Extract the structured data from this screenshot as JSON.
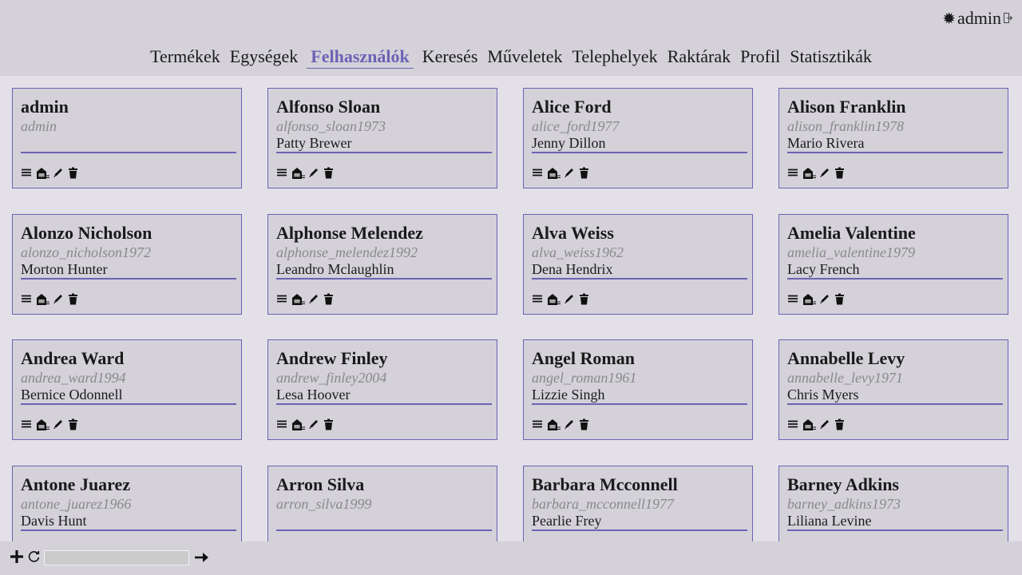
{
  "header": {
    "user_label": "admin"
  },
  "nav": {
    "items": [
      {
        "label": "Termékek",
        "name": "nav-item-termekek",
        "active": false
      },
      {
        "label": "Egységek",
        "name": "nav-item-egysegek",
        "active": false
      },
      {
        "label": "Felhasználók",
        "name": "nav-item-felhasznalok",
        "active": true
      },
      {
        "label": "Keresés",
        "name": "nav-item-kereses",
        "active": false
      },
      {
        "label": "Műveletek",
        "name": "nav-item-muveletek",
        "active": false
      },
      {
        "label": "Telephelyek",
        "name": "nav-item-telephelyek",
        "active": false
      },
      {
        "label": "Raktárak",
        "name": "nav-item-raktarak",
        "active": false
      },
      {
        "label": "Profil",
        "name": "nav-item-profil",
        "active": false
      },
      {
        "label": "Statisztikák",
        "name": "nav-item-statisztikak",
        "active": false
      }
    ]
  },
  "users": [
    {
      "name": "admin",
      "username": "admin",
      "contact": ""
    },
    {
      "name": "Alfonso Sloan",
      "username": "alfonso_sloan1973",
      "contact": "Patty Brewer"
    },
    {
      "name": "Alice Ford",
      "username": "alice_ford1977",
      "contact": "Jenny Dillon"
    },
    {
      "name": "Alison Franklin",
      "username": "alison_franklin1978",
      "contact": "Mario Rivera"
    },
    {
      "name": "Alonzo Nicholson",
      "username": "alonzo_nicholson1972",
      "contact": "Morton Hunter"
    },
    {
      "name": "Alphonse Melendez",
      "username": "alphonse_melendez1992",
      "contact": "Leandro Mclaughlin"
    },
    {
      "name": "Alva Weiss",
      "username": "alva_weiss1962",
      "contact": "Dena Hendrix"
    },
    {
      "name": "Amelia Valentine",
      "username": "amelia_valentine1979",
      "contact": "Lacy French"
    },
    {
      "name": "Andrea Ward",
      "username": "andrea_ward1994",
      "contact": "Bernice Odonnell"
    },
    {
      "name": "Andrew Finley",
      "username": "andrew_finley2004",
      "contact": "Lesa Hoover"
    },
    {
      "name": "Angel Roman",
      "username": "angel_roman1961",
      "contact": "Lizzie Singh"
    },
    {
      "name": "Annabelle Levy",
      "username": "annabelle_levy1971",
      "contact": "Chris Myers"
    },
    {
      "name": "Antone Juarez",
      "username": "antone_juarez1966",
      "contact": "Davis Hunt"
    },
    {
      "name": "Arron Silva",
      "username": "arron_silva1999",
      "contact": ""
    },
    {
      "name": "Barbara Mcconnell",
      "username": "barbara_mcconnell1977",
      "contact": "Pearlie Frey"
    },
    {
      "name": "Barney Adkins",
      "username": "barney_adkins1973",
      "contact": "Liliana Levine"
    }
  ],
  "card_actions": [
    "list-icon",
    "warehouse-icon",
    "edit-icon",
    "delete-icon"
  ],
  "footer": {
    "search_value": "",
    "search_placeholder": ""
  },
  "colors": {
    "accent": "#6b63b5",
    "header_bg": "#d4d1d9",
    "page_bg": "#e3e0e8",
    "muted_text": "#8a8a8a"
  }
}
